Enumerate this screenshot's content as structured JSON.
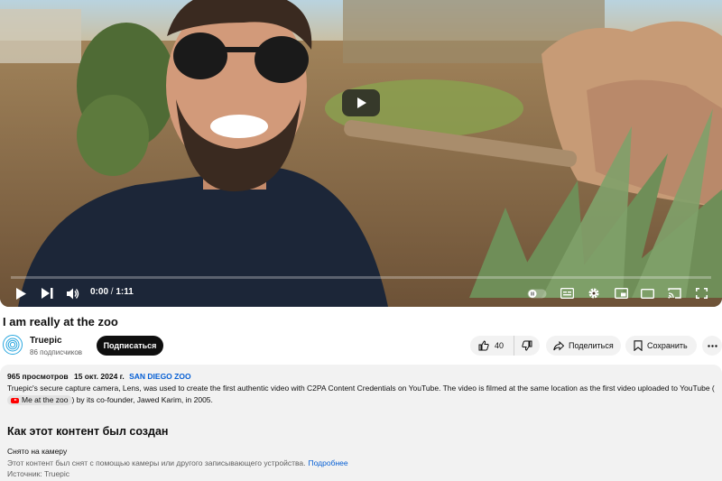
{
  "player": {
    "time_current": "0:00",
    "time_separator": " / ",
    "time_total": "1:11",
    "progress": 0.0
  },
  "video": {
    "title": "I am really at the zoo"
  },
  "channel": {
    "name": "Truepic",
    "subscribers": "86 подписчиков",
    "subscribe_label": "Подписаться"
  },
  "actions": {
    "like_count": "40",
    "share_label": "Поделиться",
    "save_label": "Сохранить"
  },
  "description": {
    "views": "965 просмотров",
    "date": "15 окт. 2024 г.",
    "hashtag": "SAN DIEGO ZOO",
    "text_before": "Truepic's secure capture camera, Lens, was used to create the first authentic video with C2PA Content Credentials on YouTube. The video is filmed at the same location as the first video uploaded to YouTube (",
    "chip_label": "Me at the zoo",
    "text_after": ") by its co-founder, Jawed Karim, in 2005."
  },
  "provenance": {
    "heading": "Как этот контент был создан",
    "label": "Снято на камеру",
    "detail": "Этот контент был снят с помощью камеры или другого записывающего устройства.",
    "more_link": "Подробнее",
    "source": "Источник: Truepic"
  },
  "colors": {
    "accent_red": "#ff0000",
    "link_blue": "#065fd4",
    "brand_ring": "#2aa7df"
  }
}
